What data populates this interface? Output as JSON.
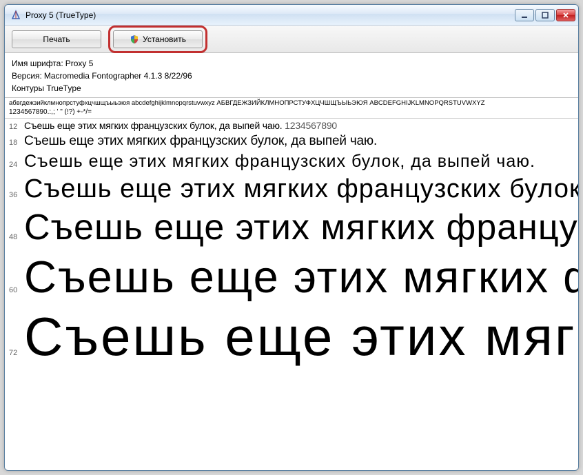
{
  "window": {
    "title": "Proxy 5 (TrueType)"
  },
  "toolbar": {
    "print_label": "Печать",
    "install_label": "Установить"
  },
  "meta": {
    "font_name_label": "Имя шрифта:",
    "font_name_value": "Proxy 5",
    "version_label": "Версия:",
    "version_value": "Macromedia Fontographer 4.1.3 8/22/96",
    "outlines": "Контуры TrueType"
  },
  "alphabet": {
    "line1": "абвгдежзийклмнопрстуфхцчшщъыьэюя abcdefghijklmnopqrstuvwxyz АБВГДЕЖЗИЙКЛМНОПРСТУФХЦЧШЩЪЫЬЭЮЯ ABCDEFGHIJKLMNOPQRSTUVWXYZ",
    "line2": "1234567890.:,; ' \" (!?) +-*/="
  },
  "pangram": "Съешь еще этих мягких французских булок, да выпей чаю.",
  "pangram_digits": "1234567890",
  "sizes": {
    "s12": "12",
    "s18": "18",
    "s24": "24",
    "s36": "36",
    "s48": "48",
    "s60": "60",
    "s72": "72"
  }
}
